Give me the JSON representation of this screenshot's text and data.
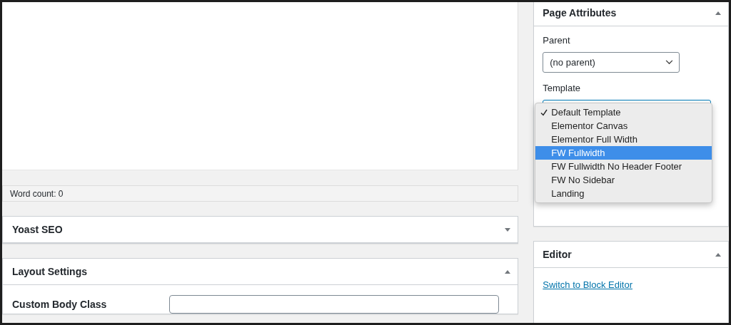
{
  "editor": {
    "word_count": "Word count: 0"
  },
  "left_panels": [
    {
      "title": "Yoast SEO",
      "expanded": false
    },
    {
      "title": "Layout Settings",
      "expanded": true,
      "fields": [
        {
          "label": "Custom Body Class"
        }
      ]
    }
  ],
  "page_attributes": {
    "title": "Page Attributes",
    "expanded": true,
    "parent_label": "Parent",
    "parent_value": "(no parent)",
    "template_label": "Template",
    "template_options": [
      {
        "label": "Default Template",
        "checked": true,
        "selected": false
      },
      {
        "label": "Elementor Canvas",
        "checked": false,
        "selected": false
      },
      {
        "label": "Elementor Full Width",
        "checked": false,
        "selected": false
      },
      {
        "label": "FW Fullwidth",
        "checked": false,
        "selected": true
      },
      {
        "label": "FW Fullwidth No Header Footer",
        "checked": false,
        "selected": false
      },
      {
        "label": "FW No Sidebar",
        "checked": false,
        "selected": false
      },
      {
        "label": "Landing",
        "checked": false,
        "selected": false
      }
    ]
  },
  "editor_panel": {
    "title": "Editor",
    "expanded": true,
    "link": "Switch to Block Editor"
  }
}
